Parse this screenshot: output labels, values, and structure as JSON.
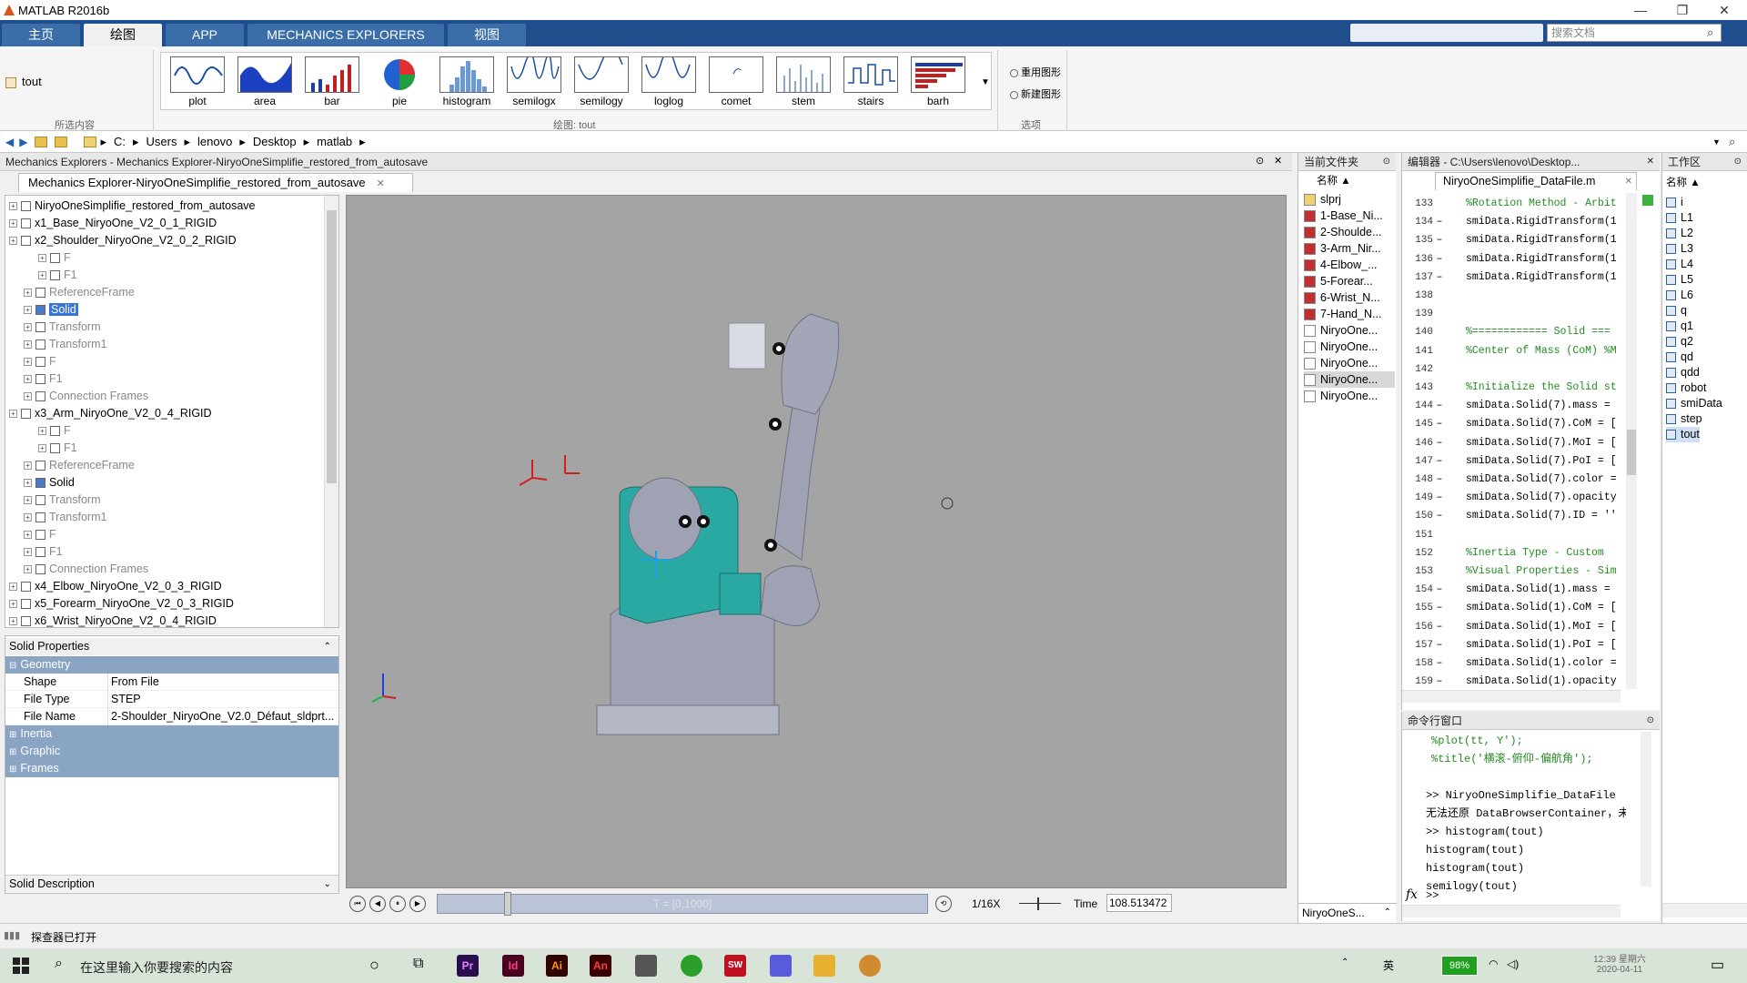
{
  "window": {
    "title": "MATLAB R2016b",
    "min": "—",
    "max": "❐",
    "close": "✕"
  },
  "ribbon_tabs": [
    "主页",
    "绘图",
    "APP",
    "MECHANICS EXPLORERS",
    "视图"
  ],
  "search": {
    "placeholder": "搜索文档"
  },
  "ribbon": {
    "selected_var": "tout",
    "selected_section": "所选内容",
    "plot_section": "绘图: tout",
    "options_section": "选项",
    "plots": [
      "plot",
      "area",
      "bar",
      "pie",
      "histogram",
      "semilogx",
      "semilogy",
      "loglog",
      "comet",
      "stem",
      "stairs",
      "barh"
    ],
    "reuse": "重用图形",
    "new_fig": "新建图形"
  },
  "address": [
    "C:",
    "Users",
    "lenovo",
    "Desktop",
    "matlab"
  ],
  "mech": {
    "window_title": "Mechanics Explorers - Mechanics Explorer-NiryoOneSimplifie_restored_from_autosave",
    "tab": "Mechanics Explorer-NiryoOneSimplifie_restored_from_autosave",
    "tree": [
      {
        "label": "NiryoOneSimplifie_restored_from_autosave",
        "level": 0,
        "dim": false
      },
      {
        "label": "x1_Base_NiryoOne_V2_0_1_RIGID",
        "level": 0,
        "dim": false
      },
      {
        "label": "x2_Shoulder_NiryoOne_V2_0_2_RIGID",
        "level": 0,
        "dim": false
      },
      {
        "label": "F",
        "level": 2,
        "dim": true
      },
      {
        "label": "F1",
        "level": 2,
        "dim": true
      },
      {
        "label": "ReferenceFrame",
        "level": 1,
        "dim": true
      },
      {
        "label": "Solid",
        "level": 1,
        "dim": false,
        "selected": true
      },
      {
        "label": "Transform",
        "level": 1,
        "dim": true
      },
      {
        "label": "Transform1",
        "level": 1,
        "dim": true
      },
      {
        "label": "F",
        "level": 1,
        "dim": true
      },
      {
        "label": "F1",
        "level": 1,
        "dim": true
      },
      {
        "label": "Connection Frames",
        "level": 1,
        "dim": true
      },
      {
        "label": "x3_Arm_NiryoOne_V2_0_4_RIGID",
        "level": 0,
        "dim": false
      },
      {
        "label": "F",
        "level": 2,
        "dim": true
      },
      {
        "label": "F1",
        "level": 2,
        "dim": true
      },
      {
        "label": "ReferenceFrame",
        "level": 1,
        "dim": true
      },
      {
        "label": "Solid",
        "level": 1,
        "dim": false
      },
      {
        "label": "Transform",
        "level": 1,
        "dim": true
      },
      {
        "label": "Transform1",
        "level": 1,
        "dim": true
      },
      {
        "label": "F",
        "level": 1,
        "dim": true
      },
      {
        "label": "F1",
        "level": 1,
        "dim": true
      },
      {
        "label": "Connection Frames",
        "level": 1,
        "dim": true
      },
      {
        "label": "x4_Elbow_NiryoOne_V2_0_3_RIGID",
        "level": 0,
        "dim": false
      },
      {
        "label": "x5_Forearm_NiryoOne_V2_0_3_RIGID",
        "level": 0,
        "dim": false
      },
      {
        "label": "x6_Wrist_NiryoOne_V2_0_4_RIGID",
        "level": 0,
        "dim": false
      }
    ],
    "props": {
      "title": "Solid Properties",
      "geometry": "Geometry",
      "rows": [
        [
          "Shape",
          "From File"
        ],
        [
          "File Type",
          "STEP"
        ],
        [
          "File Name",
          "2-Shoulder_NiryoOne_V2.0_Défaut_sldprt..."
        ]
      ],
      "sections": [
        "Inertia",
        "Graphic",
        "Frames"
      ],
      "description": "Solid Description"
    },
    "playback": {
      "time_range": "T = [0,1000]",
      "speed": "1/16X",
      "time_label": "Time",
      "time_value": "108.513472"
    }
  },
  "files": {
    "title": "当前文件夹",
    "col": "名称 ▲",
    "items": [
      "slprj",
      "1-Base_Ni...",
      "2-Shoulde...",
      "3-Arm_Nir...",
      "4-Elbow_...",
      "5-Forear...",
      "6-Wrist_N...",
      "7-Hand_N...",
      "NiryoOne...",
      "NiryoOne...",
      "NiryoOne...",
      "NiryoOne...",
      "NiryoOne..."
    ],
    "footer": "NiryoOneS..."
  },
  "editor": {
    "title": "编辑器 - C:\\Users\\lenovo\\Desktop...",
    "tab": "NiryoOneSimplifie_DataFile.m",
    "lines": [
      {
        "n": "133",
        "d": "",
        "t": "%Rotation Method - Arbit",
        "c": true
      },
      {
        "n": "134",
        "d": "–",
        "t": "smiData.RigidTransform(1",
        "c": false
      },
      {
        "n": "135",
        "d": "–",
        "t": "smiData.RigidTransform(1",
        "c": false
      },
      {
        "n": "136",
        "d": "–",
        "t": "smiData.RigidTransform(1",
        "c": false
      },
      {
        "n": "137",
        "d": "–",
        "t": "smiData.RigidTransform(1",
        "c": false
      },
      {
        "n": "138",
        "d": "",
        "t": "",
        "c": false
      },
      {
        "n": "139",
        "d": "",
        "t": "",
        "c": false
      },
      {
        "n": "140",
        "d": "",
        "t": "%============ Solid ===",
        "c": true
      },
      {
        "n": "141",
        "d": "",
        "t": "%Center of Mass (CoM) %M",
        "c": true
      },
      {
        "n": "142",
        "d": "",
        "t": "",
        "c": false
      },
      {
        "n": "143",
        "d": "",
        "t": "%Initialize the Solid st",
        "c": true
      },
      {
        "n": "144",
        "d": "–",
        "t": "smiData.Solid(7).mass =",
        "c": false
      },
      {
        "n": "145",
        "d": "–",
        "t": "smiData.Solid(7).CoM = [",
        "c": false
      },
      {
        "n": "146",
        "d": "–",
        "t": "smiData.Solid(7).MoI = [",
        "c": false
      },
      {
        "n": "147",
        "d": "–",
        "t": "smiData.Solid(7).PoI = [",
        "c": false
      },
      {
        "n": "148",
        "d": "–",
        "t": "smiData.Solid(7).color =",
        "c": false
      },
      {
        "n": "149",
        "d": "–",
        "t": "smiData.Solid(7).opacity",
        "c": false
      },
      {
        "n": "150",
        "d": "–",
        "t": "smiData.Solid(7).ID = ''",
        "c": false
      },
      {
        "n": "151",
        "d": "",
        "t": "",
        "c": false
      },
      {
        "n": "152",
        "d": "",
        "t": "%Inertia Type - Custom",
        "c": true
      },
      {
        "n": "153",
        "d": "",
        "t": "%Visual Properties - Sim",
        "c": true
      },
      {
        "n": "154",
        "d": "–",
        "t": "smiData.Solid(1).mass =",
        "c": false
      },
      {
        "n": "155",
        "d": "–",
        "t": "smiData.Solid(1).CoM = [",
        "c": false
      },
      {
        "n": "156",
        "d": "–",
        "t": "smiData.Solid(1).MoI = [",
        "c": false
      },
      {
        "n": "157",
        "d": "–",
        "t": "smiData.Solid(1).PoI = [",
        "c": false
      },
      {
        "n": "158",
        "d": "–",
        "t": "smiData.Solid(1).color =",
        "c": false
      },
      {
        "n": "159",
        "d": "–",
        "t": "smiData.Solid(1).opacity",
        "c": false
      }
    ]
  },
  "cmd": {
    "title": "命令行窗口",
    "lines": [
      "%plot(tt, Y');",
      "%title('横滚-俯仰-偏航角');",
      "",
      ">> NiryoOneSimplifie_DataFile",
      "无法还原 DataBrowserContainer，未",
      ">> histogram(tout)",
      "histogram(tout)",
      "histogram(tout)",
      "semilogy(tout)"
    ],
    "prompt": ">>"
  },
  "workspace": {
    "title": "工作区",
    "col": "名称 ▲",
    "items": [
      "i",
      "L1",
      "L2",
      "L3",
      "L4",
      "L5",
      "L6",
      "q",
      "q1",
      "q2",
      "qd",
      "qdd",
      "robot",
      "smiData",
      "step",
      "tout"
    ]
  },
  "status": "探查器已打开",
  "taskbar": {
    "search": "在这里输入你要搜索的内容",
    "battery": "98%",
    "time": "12:39 星期六",
    "date": "2020-04-11",
    "ime": "英",
    "apps": [
      "Pr",
      "Id",
      "Ai",
      "An",
      "",
      "",
      "SW",
      "",
      "",
      ""
    ]
  }
}
